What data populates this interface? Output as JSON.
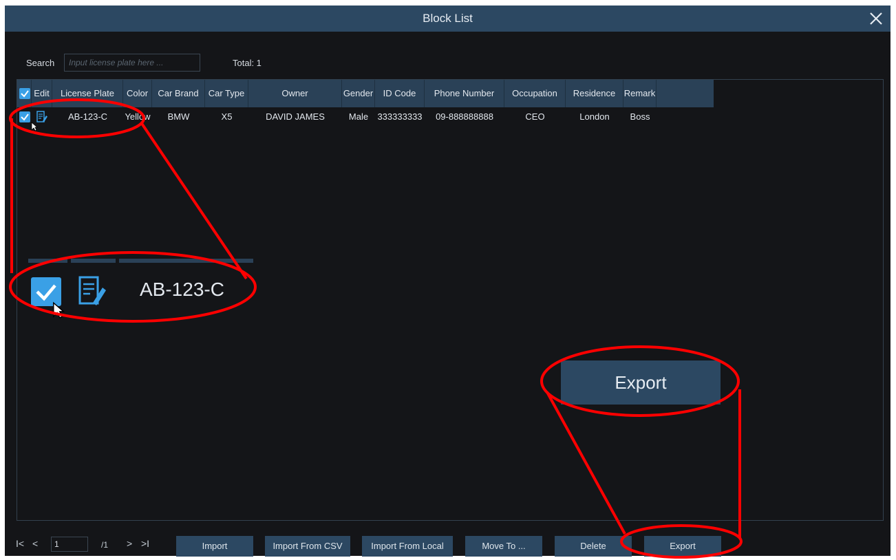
{
  "window": {
    "title": "Block List"
  },
  "search": {
    "label": "Search",
    "placeholder": "Input license plate here ...",
    "value": "",
    "total": "Total: 1"
  },
  "table": {
    "columns": [
      "Edit",
      "License Plate",
      "Color",
      "Car Brand",
      "Car Type",
      "Owner",
      "Gender",
      "ID Code",
      "Phone Number",
      "Occupation",
      "Residence",
      "Remark"
    ],
    "rows": [
      {
        "checked": true,
        "license_plate": "AB-123-C",
        "color": "Yellow",
        "car_brand": "BMW",
        "car_type": "X5",
        "owner": "DAVID JAMES",
        "gender": "Male",
        "id_code": "333333333",
        "phone_number": "09-888888888",
        "occupation": "CEO",
        "residence": "London",
        "remark": "Boss"
      }
    ]
  },
  "zoom_callout": {
    "license_plate": "AB-123-C",
    "export_label": "Export"
  },
  "pager": {
    "first": "I<",
    "prev": "<",
    "page": "1",
    "total_pages": "/1",
    "next": ">",
    "last": ">I"
  },
  "buttons": {
    "import": "Import",
    "import_csv": "Import From CSV",
    "import_local": "Import From Local",
    "move_to": "Move To ...",
    "delete": "Delete",
    "export": "Export"
  },
  "colors": {
    "titlebar": "#2c4862",
    "background": "#141518",
    "accent": "#3aa0e6",
    "annotation": "#ff0000"
  }
}
